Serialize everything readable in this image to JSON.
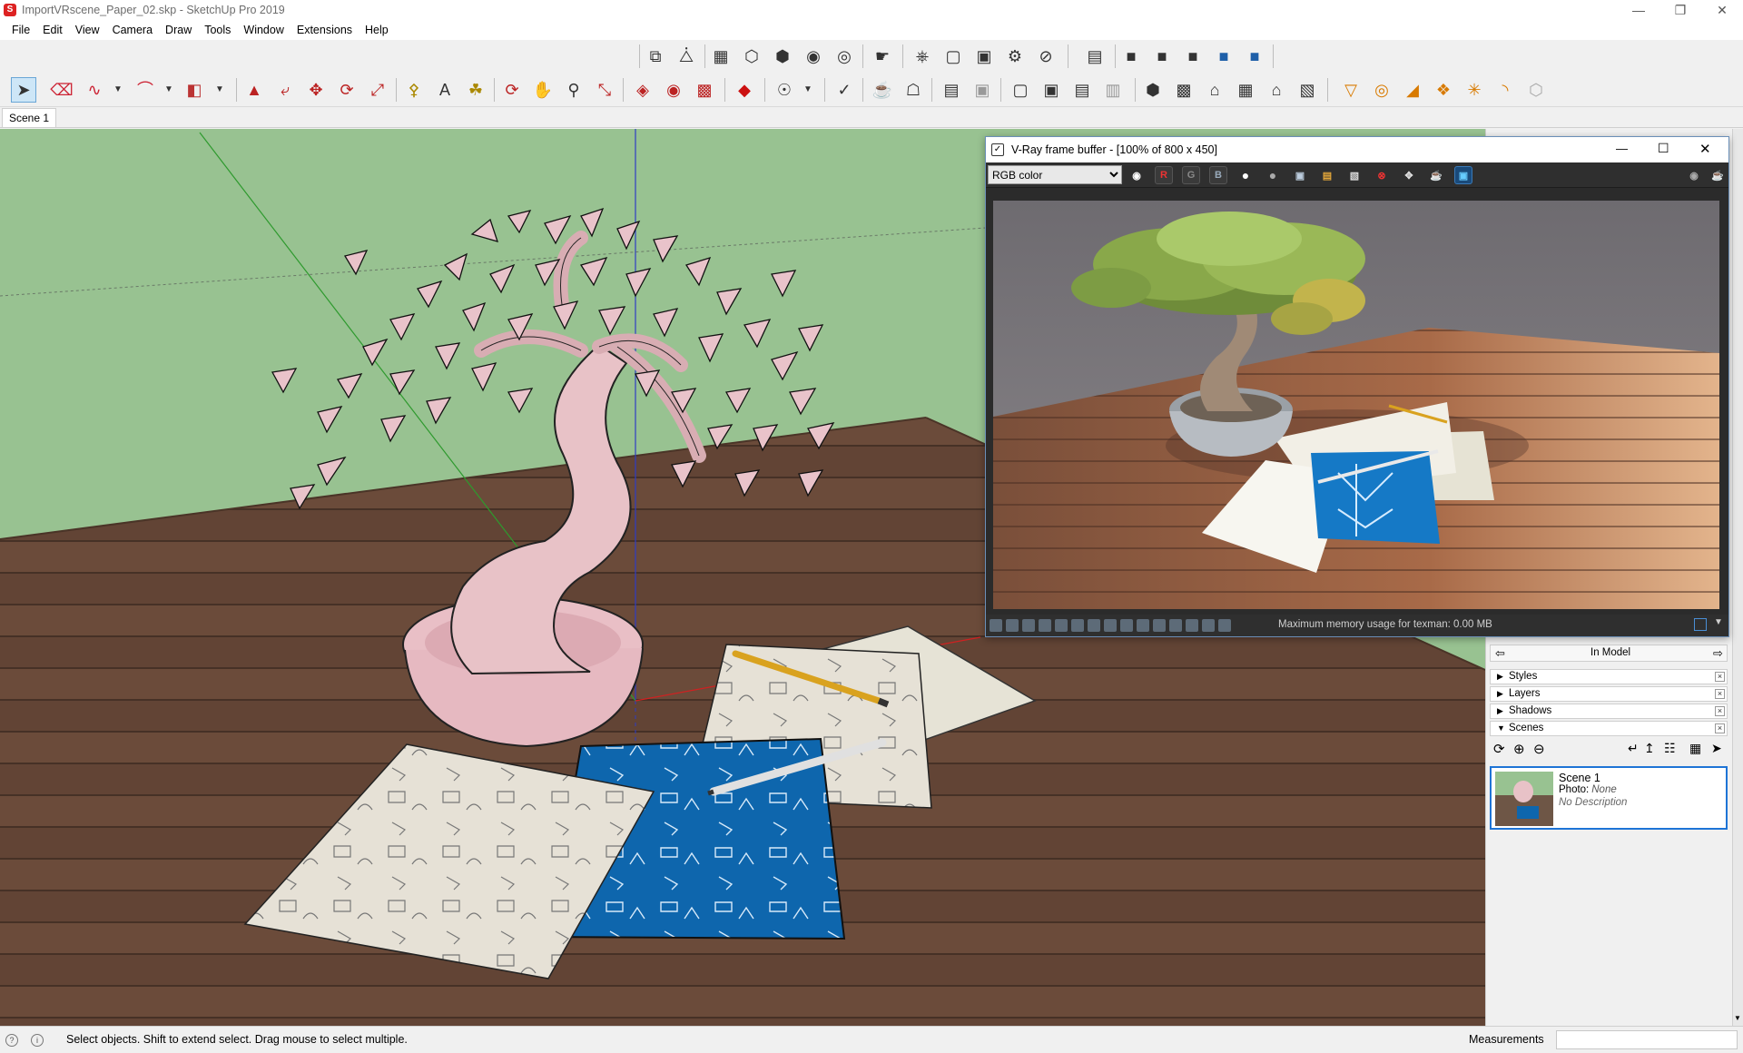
{
  "window": {
    "title": "ImportVRscene_Paper_02.skp - SketchUp Pro 2019",
    "controls": [
      "minimize-icon",
      "restore-icon",
      "close-icon"
    ]
  },
  "menu": [
    "File",
    "Edit",
    "View",
    "Camera",
    "Draw",
    "Tools",
    "Window",
    "Extensions",
    "Help"
  ],
  "toolbar1_icons": [
    "select-icon",
    "eraser-icon",
    "freehand-icon",
    "arc-icon",
    "rectangle-icon",
    "push-pull-icon",
    "follow-me-icon",
    "move-icon",
    "rotate-icon",
    "scale-icon",
    "tape-measure-icon",
    "text-icon",
    "paint-bucket-icon",
    "orbit-icon",
    "pan-icon",
    "zoom-icon",
    "zoom-extents-icon",
    "warehouse-icon",
    "extension-warehouse-icon",
    "send-to-layout-icon",
    "ruby-icon",
    "vray-asset-editor-icon",
    "vray-logo-icon",
    "teapot-icon",
    "interactive-render-icon",
    "frame-buffer-icon",
    "lights-icon",
    "section-plane-icon",
    "styles-icon",
    "views-icon",
    "shadows-icon",
    "home-icon",
    "back-view-icon",
    "front-view-icon",
    "top-view-icon",
    "sandbox-icon",
    "solid-tools-icon"
  ],
  "scene_tab": "Scene 1",
  "vfb": {
    "title": "V-Ray frame buffer - [100% of 800 x 450]",
    "channel": "RGB color",
    "channel_buttons": [
      "R",
      "G",
      "B"
    ],
    "status": "Maximum memory usage for texman: 0.00 MB"
  },
  "tray": {
    "header": "In Model",
    "panels": [
      {
        "label": "Styles",
        "expanded": false
      },
      {
        "label": "Layers",
        "expanded": false
      },
      {
        "label": "Shadows",
        "expanded": false
      },
      {
        "label": "Scenes",
        "expanded": true
      }
    ],
    "scene_card": {
      "name": "Scene 1",
      "photo_label": "Photo:",
      "photo_value": "None",
      "description": "No Description"
    }
  },
  "status": {
    "hint": "Select objects. Shift to extend select. Drag mouse to select multiple.",
    "measurements_label": "Measurements",
    "measurements_value": ""
  },
  "colors": {
    "sky": "#98c291",
    "floor": "#6b4b3a",
    "tree_pink": "#e8c2c7",
    "blueprint": "#0d6ab0",
    "selection_blue": "#1e74d6"
  }
}
